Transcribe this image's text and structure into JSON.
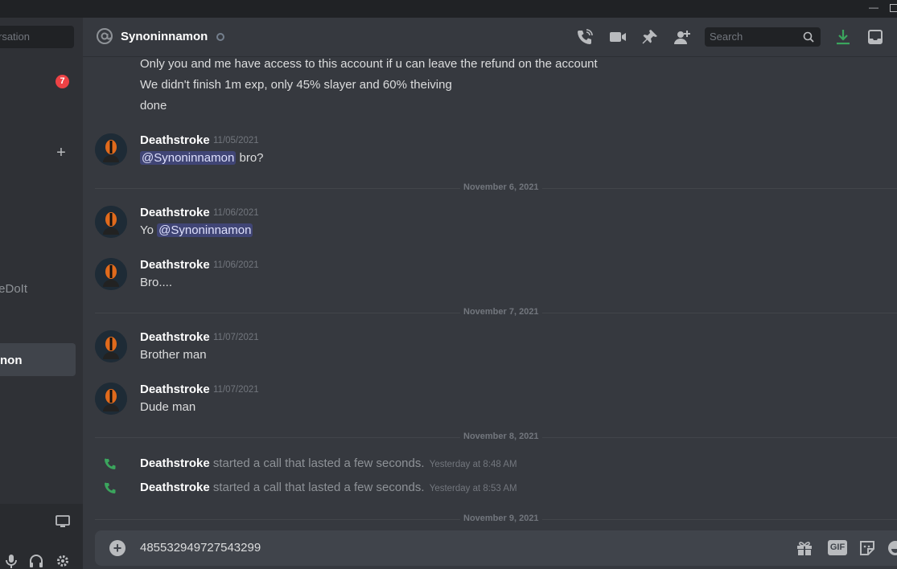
{
  "sidebar": {
    "search_placeholder": "rsation",
    "badge_count": "7",
    "plus": "+",
    "item_partial": "/eDoIt",
    "active_item_partial": "non"
  },
  "header": {
    "channel_name": "Synoninnamon",
    "search_placeholder": "Search"
  },
  "messages": {
    "top_lines": [
      "Only you and me have access to this account if u can leave the refund on the account",
      "We didn't finish 1m exp, only 45% slayer and 60% theiving",
      "done"
    ],
    "m1": {
      "author": "Deathstroke",
      "timestamp": "11/05/2021",
      "mention": "@Synoninnamon",
      "after": " bro?"
    },
    "div1": "November 6, 2021",
    "m2": {
      "author": "Deathstroke",
      "timestamp": "11/06/2021",
      "before": "Yo ",
      "mention": "@Synoninnamon"
    },
    "m3": {
      "author": "Deathstroke",
      "timestamp": "11/06/2021",
      "text": "Bro...."
    },
    "div2": "November 7, 2021",
    "m4": {
      "author": "Deathstroke",
      "timestamp": "11/07/2021",
      "text": "Brother man"
    },
    "m5": {
      "author": "Deathstroke",
      "timestamp": "11/07/2021",
      "text": "Dude man"
    },
    "div3": "November 8, 2021",
    "call1": {
      "author": "Deathstroke",
      "text": " started a call that lasted a few seconds.",
      "timestamp": "Yesterday at 8:48 AM"
    },
    "call2": {
      "author": "Deathstroke",
      "text": " started a call that lasted a few seconds.",
      "timestamp": "Yesterday at 8:53 AM"
    },
    "div4": "November 9, 2021"
  },
  "composer": {
    "value": "485532949727543299",
    "gif_label": "GIF"
  },
  "colors": {
    "accent": "#5865f2",
    "call_green": "#3ba55d",
    "badge_red": "#ed4245"
  }
}
